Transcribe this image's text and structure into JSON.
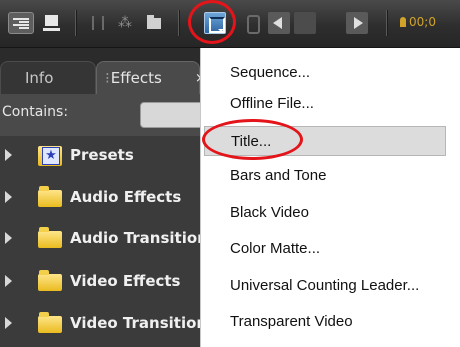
{
  "toolbar": {
    "buttons": [
      {
        "name": "list-view",
        "icon": "list-view-icon"
      },
      {
        "name": "icon-view",
        "icon": "icon-view-icon"
      },
      {
        "name": "automate-to-sequence",
        "icon": "automate-icon"
      },
      {
        "name": "find",
        "icon": "binoculars-icon"
      },
      {
        "name": "new-bin",
        "icon": "folder-icon"
      },
      {
        "name": "new-item",
        "icon": "new-item-icon",
        "highlighted": true
      },
      {
        "name": "clear",
        "icon": "trash-icon"
      },
      {
        "name": "previous",
        "icon": "triangle-left-icon"
      },
      {
        "name": "next",
        "icon": "triangle-right-icon"
      }
    ],
    "timecode": "00;0",
    "highlight_color": "#e3141a"
  },
  "panel": {
    "tabs": [
      {
        "label": "Info",
        "active": false
      },
      {
        "label": "Effects",
        "active": true,
        "close": "×"
      }
    ],
    "contains_label": "Contains:",
    "contains_value": "",
    "tree": [
      {
        "label": "Presets",
        "icon": "presets-folder-icon"
      },
      {
        "label": "Audio Effects",
        "icon": "folder-icon"
      },
      {
        "label": "Audio Transitions",
        "icon": "folder-icon"
      },
      {
        "label": "Video Effects",
        "icon": "folder-icon"
      },
      {
        "label": "Video Transitions",
        "icon": "folder-icon"
      }
    ]
  },
  "menu": {
    "items": [
      {
        "label": "Sequence..."
      },
      {
        "label": "Offline File..."
      },
      {
        "label": "Title...",
        "selected": true
      },
      {
        "label": "Bars and Tone"
      },
      {
        "label": "Black Video"
      },
      {
        "label": "Color Matte..."
      },
      {
        "label": "Universal Counting Leader..."
      },
      {
        "label": "Transparent Video"
      }
    ]
  }
}
